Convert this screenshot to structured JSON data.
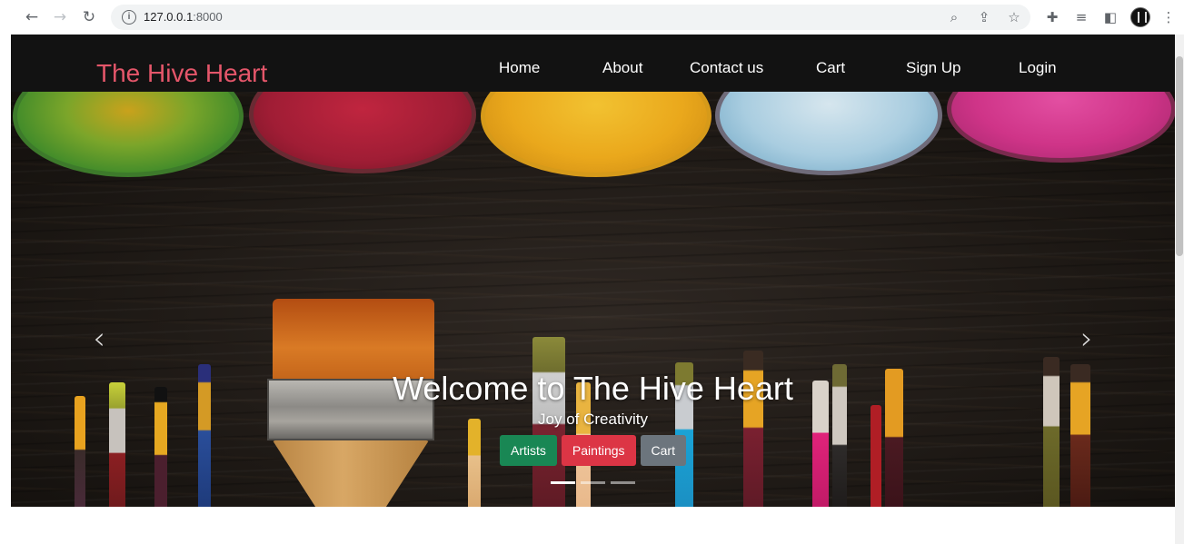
{
  "browser": {
    "url_host": "127.0.0.1",
    "url_port": ":8000"
  },
  "site": {
    "brand": "The Hive Heart",
    "nav": [
      "Home",
      "About",
      "Contact us",
      "Cart",
      "Sign Up",
      "Login"
    ]
  },
  "hero": {
    "title": "Welcome to The Hive Heart",
    "subtitle": "Joy of Creativity",
    "buttons": [
      "Artists",
      "Paintings",
      "Cart"
    ],
    "slides": 3,
    "active_slide": 1
  },
  "colors": {
    "navbar": "#121212",
    "brand": "#e4566a",
    "btn_artists": "#198754",
    "btn_paintings": "#dc3545",
    "btn_cart": "#6c757d"
  },
  "icons": [
    "back-icon",
    "forward-icon",
    "reload-icon",
    "info-icon",
    "zoom-icon",
    "share-icon",
    "star-icon",
    "extensions-icon",
    "reading-list-icon",
    "side-panel-icon",
    "profile-avatar",
    "menu-icon",
    "prev-arrow-icon",
    "next-arrow-icon"
  ]
}
